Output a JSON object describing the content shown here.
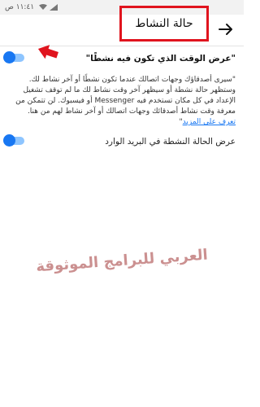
{
  "statusbar": {
    "time": "١١:٤١ ص"
  },
  "header": {
    "title": "حالة النشاط"
  },
  "setting1": {
    "label": "\"عرض الوقت الذي تكون فيه نشطًا\"",
    "enabled": true
  },
  "description": {
    "text": "\"سيرى أصدقاؤك وجهات اتصالك عندما تكون نشطًا أو آخر نشاط لك. وستظهر حالة نشطة أو سيظهر آخر وقت نشاط لك ما لم توقف تشغيل الإعداد في كل مكان تستخدم فيه Messenger أو فيسبوك. لن تتمكن من معرفة وقت نشاط أصدقائك وجهات اتصالك أو آخر نشاط لهم من هنا.",
    "link": "تعرف على المزيد",
    "closing_quote": "\""
  },
  "setting2": {
    "label": "عرض الحالة النشطة في البريد الوارد",
    "enabled": true
  },
  "watermark": "العربي للبرامج الموثوقة",
  "colors": {
    "accent": "#1877f2",
    "toggle_track": "#8ec5ff",
    "highlight_red": "#e0141e",
    "watermark": "#c27d7d"
  },
  "icons": {
    "back": "arrow-right-icon",
    "annotation": "red-arrow-icon"
  }
}
